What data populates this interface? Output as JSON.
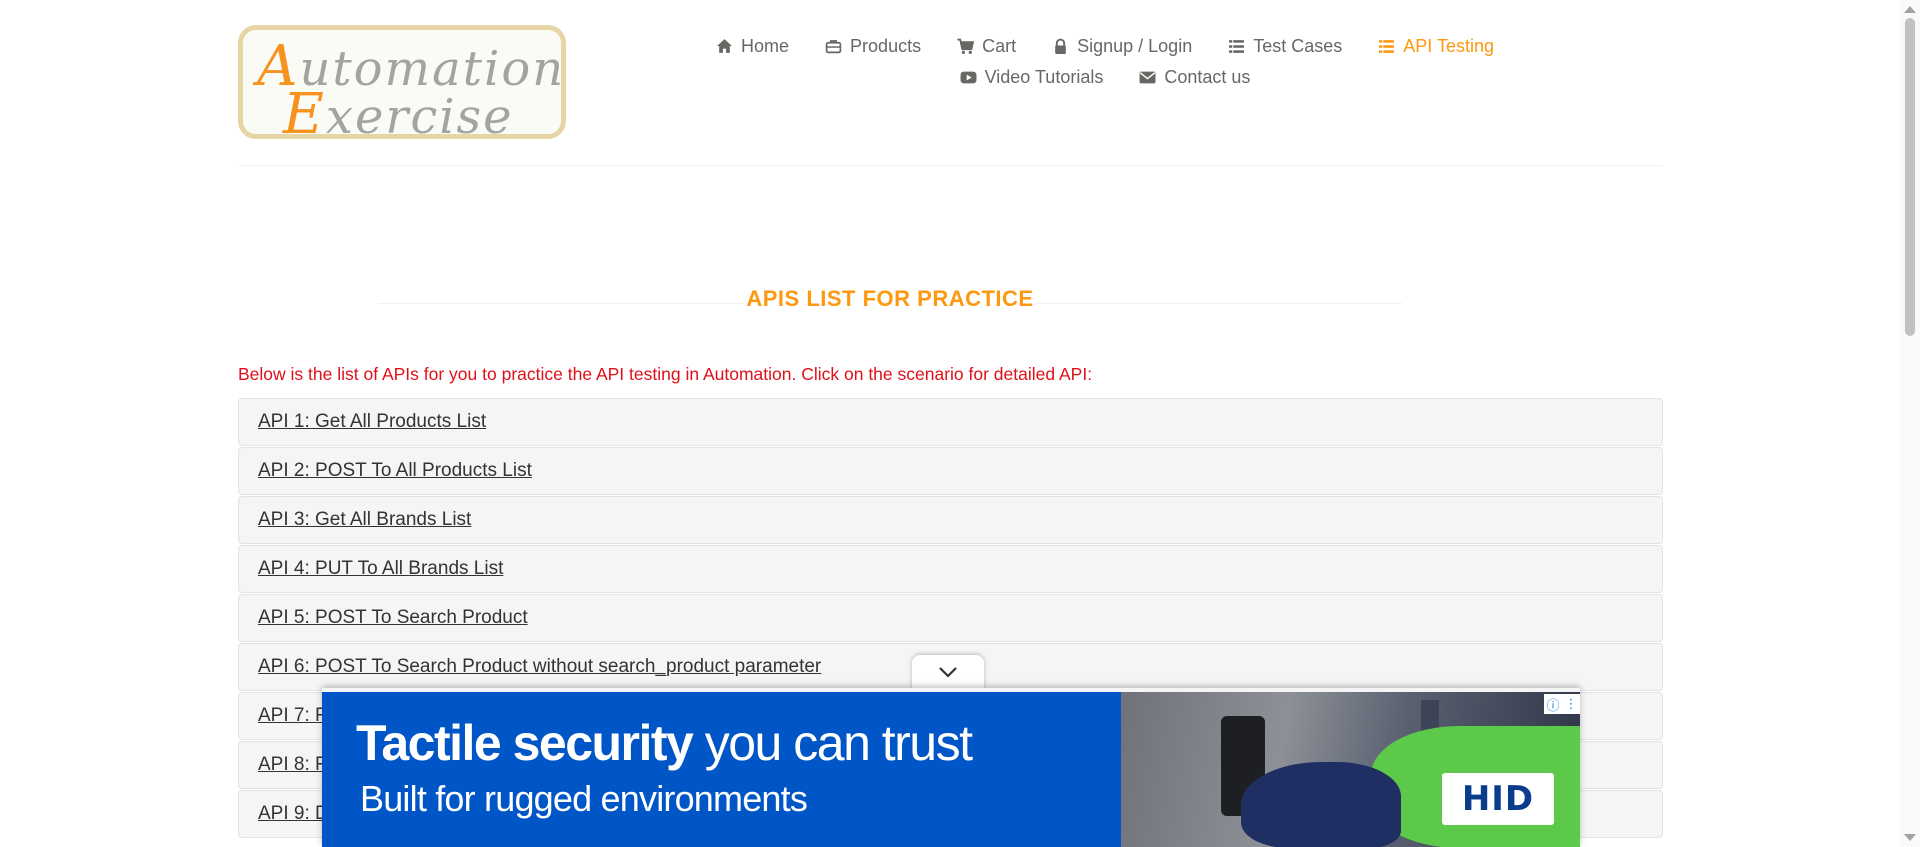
{
  "header": {
    "logo": {
      "line1": "Automation",
      "line2": "Exercise"
    },
    "nav": [
      {
        "label": "Home",
        "icon": "home-icon",
        "active": false
      },
      {
        "label": "Products",
        "icon": "briefcase-icon",
        "active": false
      },
      {
        "label": "Cart",
        "icon": "cart-icon",
        "active": false
      },
      {
        "label": "Signup / Login",
        "icon": "lock-icon",
        "active": false
      },
      {
        "label": "Test Cases",
        "icon": "list-icon",
        "active": false
      },
      {
        "label": "API Testing",
        "icon": "list-icon",
        "active": true
      },
      {
        "label": "Video Tutorials",
        "icon": "youtube-icon",
        "active": false
      },
      {
        "label": "Contact us",
        "icon": "envelope-icon",
        "active": false
      }
    ]
  },
  "main": {
    "title": "APIS LIST FOR PRACTICE",
    "intro": "Below is the list of APIs for you to practice the API testing in Automation. Click on the scenario for detailed API:",
    "apis": [
      "API 1: Get All Products List",
      "API 2: POST To All Products List",
      "API 3: Get All Brands List",
      "API 4: PUT To All Brands List",
      "API 5: POST To Search Product",
      "API 6: POST To Search Product without search_product parameter",
      "API 7: F",
      "API 8: F",
      "API 9: D"
    ]
  },
  "ad": {
    "headline_bold": "Tactile security",
    "headline_rest": " you can trust",
    "subline": "Built for rugged environments",
    "brand": "HID",
    "info_icon": "info-icon",
    "menu_icon": "more-vertical-icon"
  },
  "colors": {
    "accent": "#fe980f",
    "intro_text": "#e0101a",
    "ad_background": "#0056c6"
  }
}
